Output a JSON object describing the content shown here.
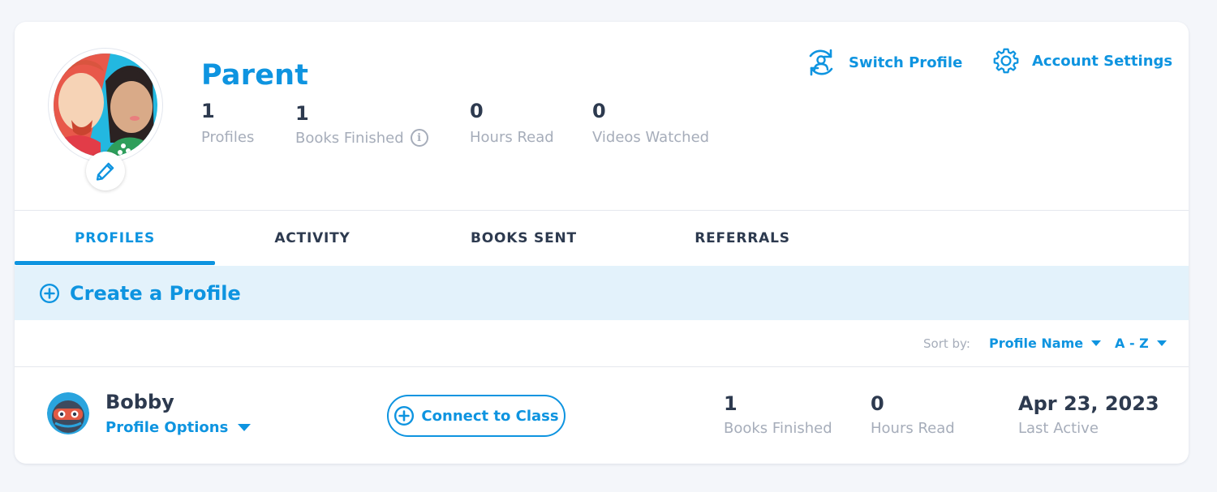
{
  "header": {
    "account_name": "Parent",
    "stats": [
      {
        "value": "1",
        "label": "Profiles"
      },
      {
        "value": "1",
        "label": "Books Finished"
      },
      {
        "value": "0",
        "label": "Hours Read"
      },
      {
        "value": "0",
        "label": "Videos Watched"
      }
    ],
    "switch_profile_label": "Switch Profile",
    "account_settings_label": "Account Settings"
  },
  "tabs": [
    {
      "label": "PROFILES",
      "active": true
    },
    {
      "label": "ACTIVITY",
      "active": false
    },
    {
      "label": "BOOKS SENT",
      "active": false
    },
    {
      "label": "REFERRALS",
      "active": false
    }
  ],
  "create_profile_label": "Create a Profile",
  "sort": {
    "label": "Sort by:",
    "field": "Profile Name",
    "order": "A - Z"
  },
  "profiles": [
    {
      "name": "Bobby",
      "options_label": "Profile Options",
      "connect_label": "Connect to Class",
      "books_finished": "1",
      "books_finished_label": "Books Finished",
      "hours_read": "0",
      "hours_read_label": "Hours Read",
      "last_active": "Apr 23, 2023",
      "last_active_label": "Last Active"
    }
  ],
  "colors": {
    "accent": "#0e94e0",
    "text_dark": "#2d3a4f",
    "text_muted": "#a6adba",
    "band_bg": "#e3f2fb"
  },
  "icons": {
    "edit": "pencil-icon",
    "switch_profile": "switch-profile-icon",
    "account_settings": "gear-icon",
    "info": "info-icon",
    "create": "plus-circle-icon",
    "connect": "plus-circle-icon",
    "dropdown": "caret-down-icon"
  }
}
